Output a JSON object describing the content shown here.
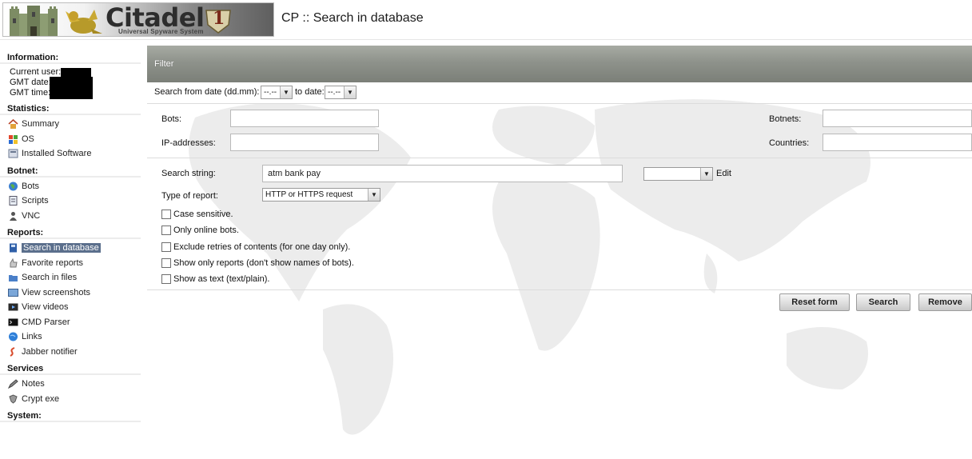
{
  "header": {
    "logo_brand": "Citadel",
    "logo_tagline": "Universal Spyware System",
    "logo_badge": "1",
    "page_title": "CP :: Search in database"
  },
  "sidebar": {
    "information": {
      "title": "Information:",
      "current_user_label": "Current user:",
      "gmt_date_label": "GMT date:",
      "gmt_time_label": "GMT time:"
    },
    "statistics": {
      "title": "Statistics:",
      "items": [
        {
          "label": "Summary",
          "icon": "house-icon"
        },
        {
          "label": "OS",
          "icon": "windows-flag-icon"
        },
        {
          "label": "Installed Software",
          "icon": "software-icon"
        }
      ]
    },
    "botnet": {
      "title": "Botnet:",
      "items": [
        {
          "label": "Bots",
          "icon": "globe-icon"
        },
        {
          "label": "Scripts",
          "icon": "script-icon"
        },
        {
          "label": "VNC",
          "icon": "vnc-user-icon"
        }
      ]
    },
    "reports": {
      "title": "Reports:",
      "items": [
        {
          "label": "Search in database",
          "icon": "database-icon",
          "active": true
        },
        {
          "label": "Favorite reports",
          "icon": "thumb-icon"
        },
        {
          "label": "Search in files",
          "icon": "folder-icon"
        },
        {
          "label": "View screenshots",
          "icon": "screenshot-icon"
        },
        {
          "label": "View videos",
          "icon": "video-icon"
        },
        {
          "label": "CMD Parser",
          "icon": "terminal-icon"
        },
        {
          "label": "Links",
          "icon": "globe-link-icon"
        },
        {
          "label": "Jabber notifier",
          "icon": "jabber-icon"
        }
      ]
    },
    "services": {
      "title": "Services",
      "items": [
        {
          "label": "Notes",
          "icon": "pen-icon"
        },
        {
          "label": "Crypt exe",
          "icon": "crypt-icon"
        }
      ]
    },
    "system": {
      "title": "System:"
    }
  },
  "filter": {
    "bar_title": "Filter",
    "date_from_label": "Search from date (dd.mm):",
    "date_from_value": "--.--",
    "date_to_label": "to date:",
    "date_to_value": "--.--",
    "bots_label": "Bots:",
    "bots_value": "",
    "botnets_label": "Botnets:",
    "botnets_value": "",
    "ip_label": "IP-addresses:",
    "ip_value": "",
    "countries_label": "Countries:",
    "countries_value": "",
    "search_string_label": "Search string:",
    "search_string_value": "atm bank pay",
    "preset_value": "",
    "edit_link": "Edit",
    "report_type_label": "Type of report:",
    "report_type_value": "HTTP or HTTPS request",
    "checkboxes": [
      {
        "label": "Case sensitive.",
        "checked": false
      },
      {
        "label": "Only online bots.",
        "checked": false
      },
      {
        "label": "Exclude retries of contents (for one day only).",
        "checked": false
      },
      {
        "label": "Show only reports (don't show names of bots).",
        "checked": false
      },
      {
        "label": "Show as text (text/plain).",
        "checked": false
      }
    ],
    "buttons": {
      "reset": "Reset form",
      "search": "Search",
      "remove": "Remove"
    }
  },
  "colors": {
    "filter_bar": "#8e928b",
    "active_nav": "#5b6f8c",
    "map": "#e9e9e9"
  }
}
